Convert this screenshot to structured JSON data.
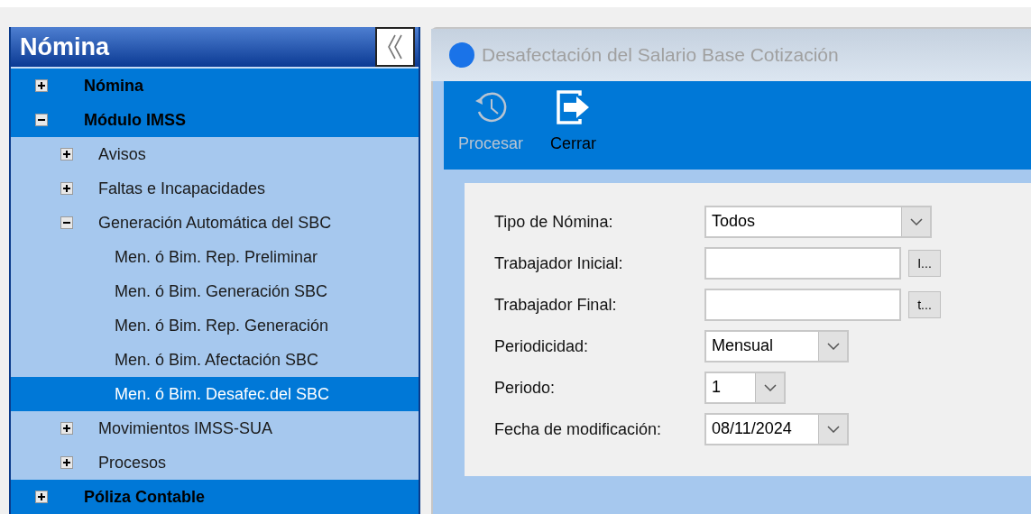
{
  "sidebar": {
    "title": "Nómina",
    "tree": [
      {
        "label": "Nómina",
        "expanded": false,
        "selected": false
      },
      {
        "label": "Módulo IMSS",
        "expanded": true,
        "selected": false,
        "children": [
          {
            "label": "Avisos",
            "expanded": false,
            "selected": false
          },
          {
            "label": "Faltas e Incapacidades",
            "expanded": false,
            "selected": false
          },
          {
            "label": "Generación Automática del SBC",
            "expanded": true,
            "selected": false,
            "children": [
              {
                "label": "Men. ó Bim. Rep. Preliminar",
                "selected": false
              },
              {
                "label": "Men. ó Bim. Generación SBC",
                "selected": false
              },
              {
                "label": "Men. ó Bim. Rep. Generación",
                "selected": false
              },
              {
                "label": "Men. ó Bim. Afectación SBC",
                "selected": false
              },
              {
                "label": "Men. ó Bim. Desafec.del SBC",
                "selected": true
              }
            ]
          },
          {
            "label": "Movimientos IMSS-SUA",
            "expanded": false,
            "selected": false
          },
          {
            "label": "Procesos",
            "expanded": false,
            "selected": false
          }
        ]
      },
      {
        "label": "Póliza Contable",
        "expanded": false,
        "selected": false
      }
    ]
  },
  "window": {
    "title": "Desafectación del Salario Base Cotización",
    "toolbar": [
      {
        "kind": "history",
        "label": "Procesar",
        "disabled": true
      },
      {
        "kind": "exit",
        "label": "Cerrar",
        "disabled": false
      }
    ],
    "form": [
      {
        "kind": "select",
        "label": "Tipo de Nómina:",
        "value": "Todos"
      },
      {
        "kind": "lookup",
        "label": "Trabajador Inicial:",
        "button": "I..."
      },
      {
        "kind": "lookup",
        "label": "Trabajador Final:",
        "button": "t..."
      },
      {
        "kind": "select",
        "label": "Periodicidad:",
        "value": "Mensual"
      },
      {
        "kind": "select",
        "label": "Periodo:",
        "value": "1"
      },
      {
        "kind": "select",
        "label": "Fecha de modificación:",
        "value": "08/11/2024"
      }
    ]
  }
}
